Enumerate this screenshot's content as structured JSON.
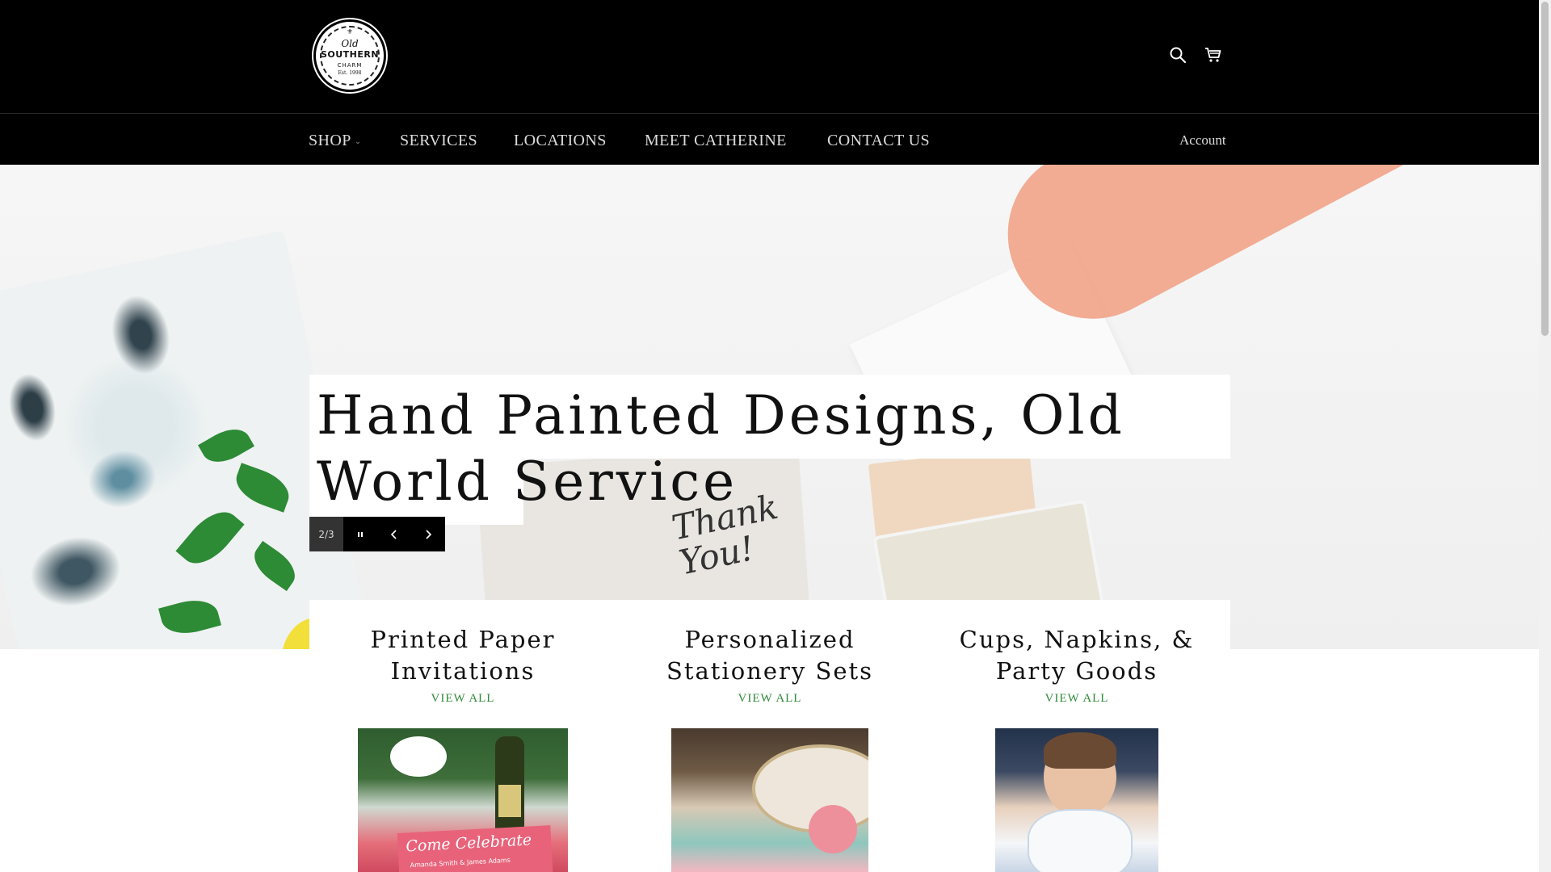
{
  "header": {
    "logo": {
      "line1": "Old",
      "line2": "SOUTHERN",
      "line3": "CHARM",
      "line4": "Est. 1998"
    },
    "icons": [
      "search-icon",
      "cart-icon"
    ]
  },
  "nav": {
    "items": [
      {
        "label": "SHOP",
        "has_dropdown": true
      },
      {
        "label": "SERVICES"
      },
      {
        "label": "LOCATIONS"
      },
      {
        "label": "MEET CATHERINE"
      },
      {
        "label": "CONTACT US"
      }
    ],
    "account_label": "Account"
  },
  "hero": {
    "headline": "Hand Painted Designs, Old World Service",
    "card_text": "Thank You!",
    "slide_counter": "2/3",
    "controls": [
      "pause-icon",
      "chevron-left-icon",
      "chevron-right-icon"
    ]
  },
  "collections": [
    {
      "title": "Printed Paper Invitations",
      "link": "VIEW ALL",
      "image_text": "Come Celebrate",
      "image_subtext": "Amanda Smith & James Adams"
    },
    {
      "title": "Personalized Stationery Sets",
      "link": "VIEW ALL"
    },
    {
      "title": "Cups, Napkins, & Party Goods",
      "link": "VIEW ALL"
    }
  ],
  "colors": {
    "header_bg": "#000000",
    "nav_text": "#dcdcdc",
    "link_green": "#2f8a3a"
  }
}
